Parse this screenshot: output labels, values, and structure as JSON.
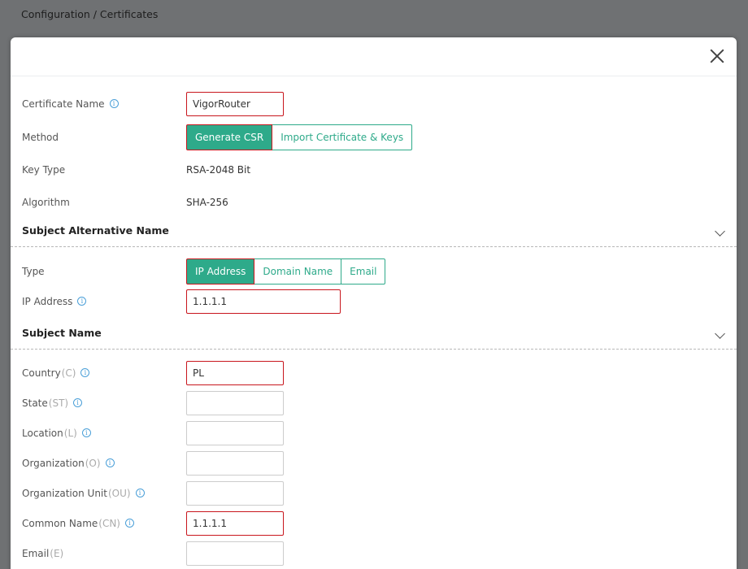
{
  "breadcrumb": "Configuration / Certificates",
  "colors": {
    "accent": "#2eaa8a",
    "highlight": "#c8161d"
  },
  "form": {
    "certificate_name": {
      "label": "Certificate Name",
      "value": "VigorRouter"
    },
    "method": {
      "label": "Method",
      "options": [
        "Generate CSR",
        "Import Certificate & Keys"
      ],
      "selected": "Generate CSR"
    },
    "key_type": {
      "label": "Key Type",
      "value": "RSA-2048 Bit"
    },
    "algorithm": {
      "label": "Algorithm",
      "value": "SHA-256"
    }
  },
  "san": {
    "title": "Subject Alternative Name",
    "type": {
      "label": "Type",
      "options": [
        "IP Address",
        "Domain Name",
        "Email"
      ],
      "selected": "IP Address"
    },
    "ip_address": {
      "label": "IP Address",
      "value": "1.1.1.1"
    }
  },
  "subject": {
    "title": "Subject Name",
    "country": {
      "label": "Country",
      "suffix": "(C)",
      "value": "PL"
    },
    "state": {
      "label": "State",
      "suffix": "(ST)",
      "value": ""
    },
    "location": {
      "label": "Location",
      "suffix": "(L)",
      "value": ""
    },
    "organization": {
      "label": "Organization",
      "suffix": "(O)",
      "value": ""
    },
    "org_unit": {
      "label": "Organization Unit",
      "suffix": "(OU)",
      "value": ""
    },
    "common_name": {
      "label": "Common Name",
      "suffix": "(CN)",
      "value": "1.1.1.1"
    },
    "email": {
      "label": "Email",
      "suffix": "(E)",
      "value": ""
    }
  }
}
